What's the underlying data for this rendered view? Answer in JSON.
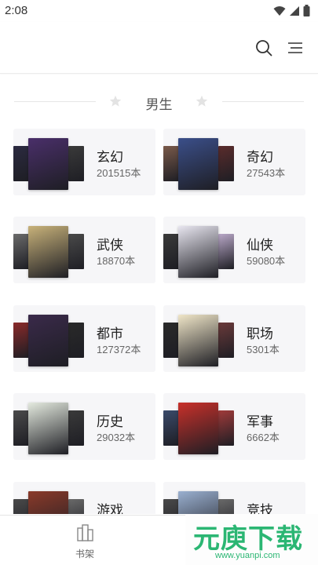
{
  "status_bar": {
    "time": "2:08"
  },
  "toolbar": {
    "search_icon": "search-icon",
    "menu_icon": "list-menu-icon"
  },
  "section": {
    "title": "男生"
  },
  "categories": [
    {
      "name": "玄幻",
      "count": "201515本",
      "colors": [
        "#2b2a40",
        "#4a2f6a",
        "#3a3a3a"
      ]
    },
    {
      "name": "奇幻",
      "count": "27543本",
      "colors": [
        "#7a5a4a",
        "#3b4f8a",
        "#5a2c2c"
      ]
    },
    {
      "name": "武侠",
      "count": "18870本",
      "colors": [
        "#6a6a6a",
        "#c8b27a",
        "#4a4a4a"
      ]
    },
    {
      "name": "仙侠",
      "count": "59080本",
      "colors": [
        "#3a3a3a",
        "#e8e6f0",
        "#b9a8c8"
      ]
    },
    {
      "name": "都市",
      "count": "127372本",
      "colors": [
        "#8a2a2a",
        "#3a2a4a",
        "#2a2a2a"
      ]
    },
    {
      "name": "职场",
      "count": "5301本",
      "colors": [
        "#2a2a2a",
        "#f0e6c8",
        "#6a3a3a"
      ]
    },
    {
      "name": "历史",
      "count": "29032本",
      "colors": [
        "#4a4a4a",
        "#e4eadf",
        "#3a3a3a"
      ]
    },
    {
      "name": "军事",
      "count": "6662本",
      "colors": [
        "#3a4a6a",
        "#c8302a",
        "#a03a3a"
      ]
    },
    {
      "name": "游戏",
      "count": "",
      "colors": [
        "#4a4a4a",
        "#8a3a2a",
        "#6a6a6a"
      ]
    },
    {
      "name": "竞技",
      "count": "",
      "colors": [
        "#4a4a4a",
        "#9ab0d0",
        "#6a6a6a"
      ]
    }
  ],
  "bottom_nav": {
    "bookshelf_label": "书架"
  },
  "watermark": {
    "brand": "元庾下载",
    "url": "www.yuanpi.com"
  }
}
